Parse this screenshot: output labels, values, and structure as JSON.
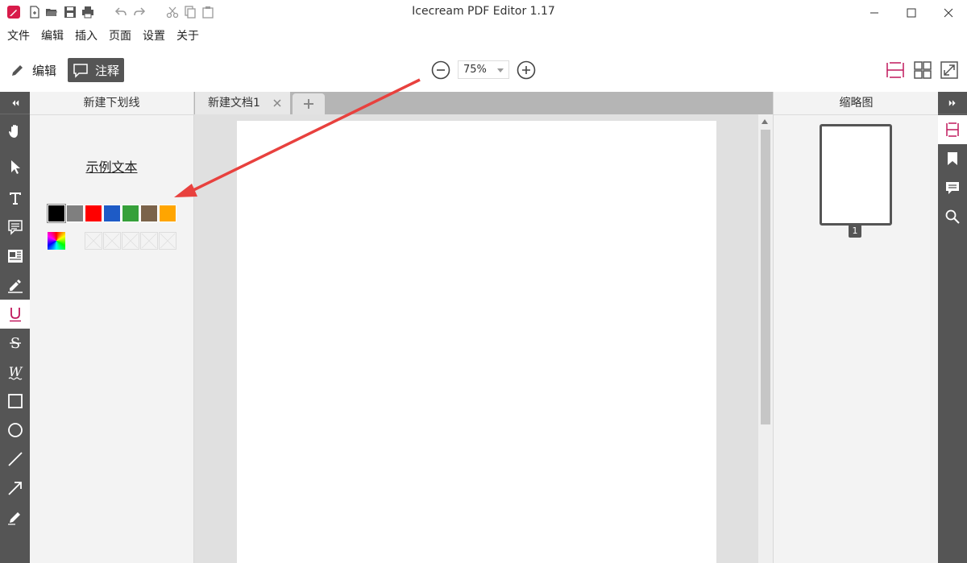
{
  "window": {
    "title": "Icecream PDF Editor 1.17",
    "quick_access_icons": [
      "app-logo-icon",
      "new-file-icon",
      "open-folder-icon",
      "save-icon",
      "print-icon",
      "undo-icon",
      "redo-icon",
      "cut-icon",
      "copy-icon",
      "paste-icon"
    ]
  },
  "menu": [
    "文件",
    "编辑",
    "插入",
    "页面",
    "设置",
    "关于"
  ],
  "toolbar": {
    "edit_label": "编辑",
    "annotate_label": "注释",
    "zoom_value": "75%"
  },
  "left_tools": [
    "collapse",
    "hand",
    "select",
    "text",
    "comment",
    "text-box",
    "highlight",
    "underline",
    "strikeout",
    "squiggly",
    "rectangle",
    "ellipse",
    "line",
    "arrow",
    "pencil"
  ],
  "active_tool": "underline",
  "props_panel": {
    "title": "新建下划线",
    "sample_text": "示例文本",
    "colors": [
      "#000000",
      "#7f7f7f",
      "#ff0000",
      "#1e5bc6",
      "#36a03a",
      "#7b634a",
      "#ffa500"
    ],
    "selected_color": "#000000"
  },
  "document": {
    "tab_label": "新建文档1",
    "page_count_label": "1"
  },
  "thumbnails_panel": {
    "title": "缩略图"
  },
  "right_tools": [
    "expand",
    "thumbnails",
    "bookmarks",
    "comments",
    "search"
  ],
  "colors": {
    "accent": "#c0185d",
    "toolbar_dark": "#555555",
    "arrow_annotation": "#e8413e"
  }
}
